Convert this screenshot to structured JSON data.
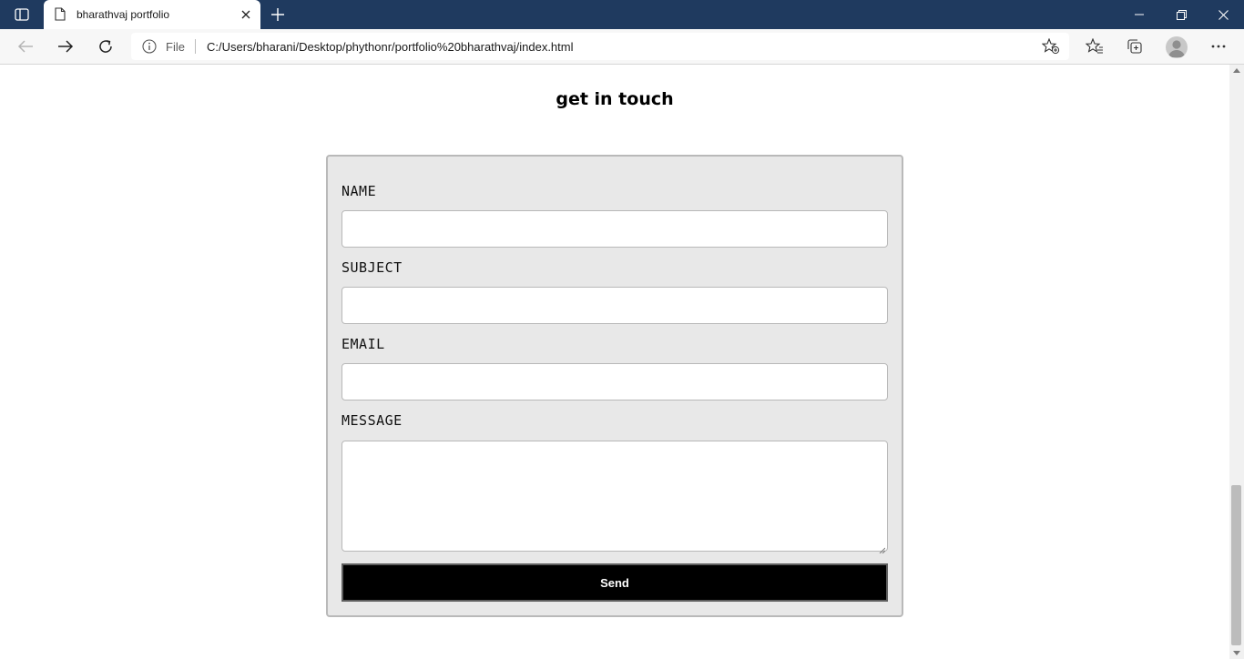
{
  "browser": {
    "tab": {
      "title": "bharathvaj portfolio"
    },
    "address_bar": {
      "scheme_label": "File",
      "url": "C:/Users/bharani/Desktop/phythonr/portfolio%20bharathvaj/index.html"
    }
  },
  "page": {
    "section_title": "get in touch",
    "form": {
      "fields": [
        {
          "label": "NAME",
          "value": ""
        },
        {
          "label": "SUBJECT",
          "value": ""
        },
        {
          "label": "EMAIL",
          "value": ""
        },
        {
          "label": "MESSAGE",
          "value": ""
        }
      ],
      "submit_label": "Send"
    }
  },
  "colors": {
    "titlebar": "#1f3a5f",
    "form_background": "#e8e8e8",
    "button_background": "#000000"
  }
}
